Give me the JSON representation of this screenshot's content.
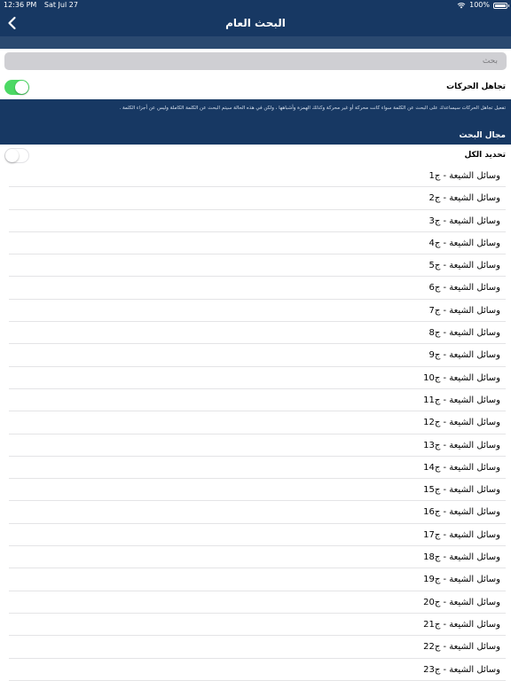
{
  "status_bar": {
    "time": "12:36 PM",
    "date": "Sat Jul 27",
    "battery": "100%",
    "battery_level": 1.0
  },
  "nav": {
    "title": "البحث العام",
    "back_icon": "chevron-left-icon"
  },
  "search": {
    "placeholder": "بحث",
    "value": ""
  },
  "ignore_diacritics": {
    "label": "تجاهل الحركات",
    "enabled": true
  },
  "info": {
    "description": "تفعيل تجاهل الحركات سيساعدك على البحث عن الكلمة سواء كانت محركة أو غير محركة وكذلك الهمزة وأشباهها ، ولكن في هذه الحالة سيتم البحث عن الكلمة الكاملة وليس عن أجزاء الكلمة .",
    "section_title": "مجال البحث"
  },
  "select_all": {
    "label": "تحديد الكل",
    "enabled": false
  },
  "volumes": [
    "وسائل الشيعة - ج1",
    "وسائل الشيعة - ج2",
    "وسائل الشيعة - ج3",
    "وسائل الشيعة - ج4",
    "وسائل الشيعة - ج5",
    "وسائل الشيعة - ج6",
    "وسائل الشيعة - ج7",
    "وسائل الشيعة - ج8",
    "وسائل الشيعة - ج9",
    "وسائل الشيعة - ج10",
    "وسائل الشيعة - ج11",
    "وسائل الشيعة - ج12",
    "وسائل الشيعة - ج13",
    "وسائل الشيعة - ج14",
    "وسائل الشيعة - ج15",
    "وسائل الشيعة - ج16",
    "وسائل الشيعة - ج17",
    "وسائل الشيعة - ج18",
    "وسائل الشيعة - ج19",
    "وسائل الشيعة - ج20",
    "وسائل الشيعة - ج21",
    "وسائل الشيعة - ج22",
    "وسائل الشيعة - ج23"
  ],
  "colors": {
    "nav_bg": "#173863",
    "toggle_on": "#4cd964"
  }
}
